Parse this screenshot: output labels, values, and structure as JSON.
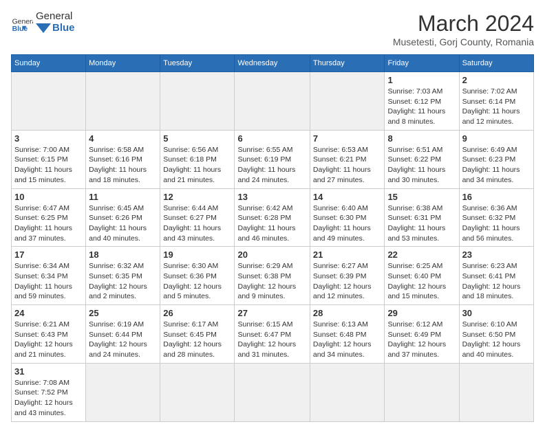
{
  "header": {
    "logo_text_normal": "General",
    "logo_text_bold": "Blue",
    "month_title": "March 2024",
    "location": "Musetesti, Gorj County, Romania"
  },
  "weekdays": [
    "Sunday",
    "Monday",
    "Tuesday",
    "Wednesday",
    "Thursday",
    "Friday",
    "Saturday"
  ],
  "weeks": [
    [
      {
        "day": "",
        "info": ""
      },
      {
        "day": "",
        "info": ""
      },
      {
        "day": "",
        "info": ""
      },
      {
        "day": "",
        "info": ""
      },
      {
        "day": "",
        "info": ""
      },
      {
        "day": "1",
        "info": "Sunrise: 7:03 AM\nSunset: 6:12 PM\nDaylight: 11 hours\nand 8 minutes."
      },
      {
        "day": "2",
        "info": "Sunrise: 7:02 AM\nSunset: 6:14 PM\nDaylight: 11 hours\nand 12 minutes."
      }
    ],
    [
      {
        "day": "3",
        "info": "Sunrise: 7:00 AM\nSunset: 6:15 PM\nDaylight: 11 hours\nand 15 minutes."
      },
      {
        "day": "4",
        "info": "Sunrise: 6:58 AM\nSunset: 6:16 PM\nDaylight: 11 hours\nand 18 minutes."
      },
      {
        "day": "5",
        "info": "Sunrise: 6:56 AM\nSunset: 6:18 PM\nDaylight: 11 hours\nand 21 minutes."
      },
      {
        "day": "6",
        "info": "Sunrise: 6:55 AM\nSunset: 6:19 PM\nDaylight: 11 hours\nand 24 minutes."
      },
      {
        "day": "7",
        "info": "Sunrise: 6:53 AM\nSunset: 6:21 PM\nDaylight: 11 hours\nand 27 minutes."
      },
      {
        "day": "8",
        "info": "Sunrise: 6:51 AM\nSunset: 6:22 PM\nDaylight: 11 hours\nand 30 minutes."
      },
      {
        "day": "9",
        "info": "Sunrise: 6:49 AM\nSunset: 6:23 PM\nDaylight: 11 hours\nand 34 minutes."
      }
    ],
    [
      {
        "day": "10",
        "info": "Sunrise: 6:47 AM\nSunset: 6:25 PM\nDaylight: 11 hours\nand 37 minutes."
      },
      {
        "day": "11",
        "info": "Sunrise: 6:45 AM\nSunset: 6:26 PM\nDaylight: 11 hours\nand 40 minutes."
      },
      {
        "day": "12",
        "info": "Sunrise: 6:44 AM\nSunset: 6:27 PM\nDaylight: 11 hours\nand 43 minutes."
      },
      {
        "day": "13",
        "info": "Sunrise: 6:42 AM\nSunset: 6:28 PM\nDaylight: 11 hours\nand 46 minutes."
      },
      {
        "day": "14",
        "info": "Sunrise: 6:40 AM\nSunset: 6:30 PM\nDaylight: 11 hours\nand 49 minutes."
      },
      {
        "day": "15",
        "info": "Sunrise: 6:38 AM\nSunset: 6:31 PM\nDaylight: 11 hours\nand 53 minutes."
      },
      {
        "day": "16",
        "info": "Sunrise: 6:36 AM\nSunset: 6:32 PM\nDaylight: 11 hours\nand 56 minutes."
      }
    ],
    [
      {
        "day": "17",
        "info": "Sunrise: 6:34 AM\nSunset: 6:34 PM\nDaylight: 11 hours\nand 59 minutes."
      },
      {
        "day": "18",
        "info": "Sunrise: 6:32 AM\nSunset: 6:35 PM\nDaylight: 12 hours\nand 2 minutes."
      },
      {
        "day": "19",
        "info": "Sunrise: 6:30 AM\nSunset: 6:36 PM\nDaylight: 12 hours\nand 5 minutes."
      },
      {
        "day": "20",
        "info": "Sunrise: 6:29 AM\nSunset: 6:38 PM\nDaylight: 12 hours\nand 9 minutes."
      },
      {
        "day": "21",
        "info": "Sunrise: 6:27 AM\nSunset: 6:39 PM\nDaylight: 12 hours\nand 12 minutes."
      },
      {
        "day": "22",
        "info": "Sunrise: 6:25 AM\nSunset: 6:40 PM\nDaylight: 12 hours\nand 15 minutes."
      },
      {
        "day": "23",
        "info": "Sunrise: 6:23 AM\nSunset: 6:41 PM\nDaylight: 12 hours\nand 18 minutes."
      }
    ],
    [
      {
        "day": "24",
        "info": "Sunrise: 6:21 AM\nSunset: 6:43 PM\nDaylight: 12 hours\nand 21 minutes."
      },
      {
        "day": "25",
        "info": "Sunrise: 6:19 AM\nSunset: 6:44 PM\nDaylight: 12 hours\nand 24 minutes."
      },
      {
        "day": "26",
        "info": "Sunrise: 6:17 AM\nSunset: 6:45 PM\nDaylight: 12 hours\nand 28 minutes."
      },
      {
        "day": "27",
        "info": "Sunrise: 6:15 AM\nSunset: 6:47 PM\nDaylight: 12 hours\nand 31 minutes."
      },
      {
        "day": "28",
        "info": "Sunrise: 6:13 AM\nSunset: 6:48 PM\nDaylight: 12 hours\nand 34 minutes."
      },
      {
        "day": "29",
        "info": "Sunrise: 6:12 AM\nSunset: 6:49 PM\nDaylight: 12 hours\nand 37 minutes."
      },
      {
        "day": "30",
        "info": "Sunrise: 6:10 AM\nSunset: 6:50 PM\nDaylight: 12 hours\nand 40 minutes."
      }
    ],
    [
      {
        "day": "31",
        "info": "Sunrise: 7:08 AM\nSunset: 7:52 PM\nDaylight: 12 hours\nand 43 minutes."
      },
      {
        "day": "",
        "info": ""
      },
      {
        "day": "",
        "info": ""
      },
      {
        "day": "",
        "info": ""
      },
      {
        "day": "",
        "info": ""
      },
      {
        "day": "",
        "info": ""
      },
      {
        "day": "",
        "info": ""
      }
    ]
  ]
}
